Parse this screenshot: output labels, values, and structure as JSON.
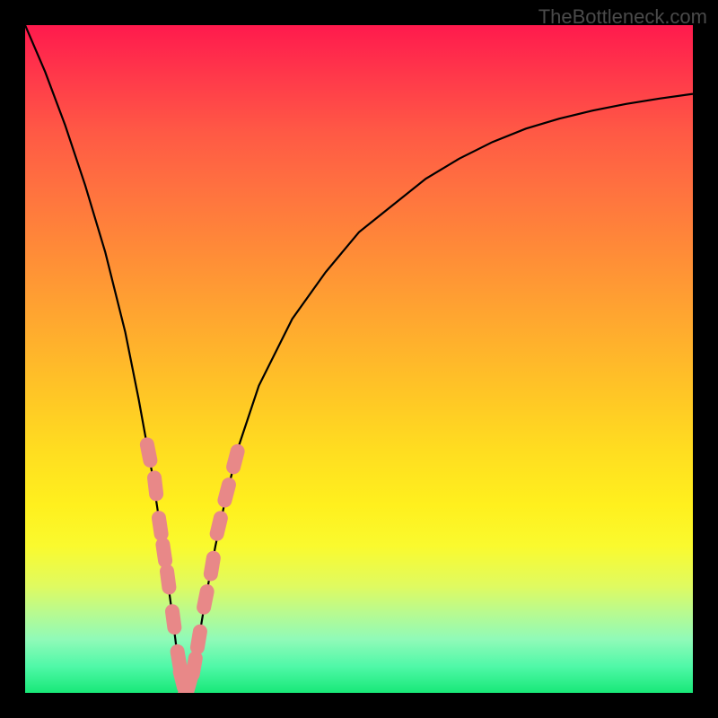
{
  "watermark": "TheBottleneck.com",
  "chart_data": {
    "type": "line",
    "title": "",
    "xlabel": "",
    "ylabel": "",
    "xlim": [
      0,
      100
    ],
    "ylim": [
      0,
      100
    ],
    "minimum_x": 24,
    "series": [
      {
        "name": "curve",
        "x": [
          0,
          3,
          6,
          9,
          12,
          15,
          17,
          19,
          20.5,
          22,
          23,
          24,
          25,
          26,
          27,
          28.5,
          30,
          32,
          35,
          40,
          45,
          50,
          55,
          60,
          65,
          70,
          75,
          80,
          85,
          90,
          95,
          100
        ],
        "y": [
          100,
          93,
          85,
          76,
          66,
          54,
          44,
          33,
          23,
          12,
          4,
          0,
          3,
          8,
          14,
          22,
          29,
          37,
          46,
          56,
          63,
          69,
          73,
          77,
          80,
          82.5,
          84.5,
          86,
          87.2,
          88.2,
          89,
          89.7
        ]
      }
    ],
    "markers": {
      "name": "highlighted-points",
      "color": "#e88888",
      "points": [
        {
          "x": 18.5,
          "y": 36
        },
        {
          "x": 19.5,
          "y": 31
        },
        {
          "x": 20.2,
          "y": 25
        },
        {
          "x": 20.8,
          "y": 21
        },
        {
          "x": 21.4,
          "y": 17
        },
        {
          "x": 22.2,
          "y": 11
        },
        {
          "x": 23,
          "y": 5
        },
        {
          "x": 23.5,
          "y": 2
        },
        {
          "x": 24,
          "y": 0
        },
        {
          "x": 24.6,
          "y": 1.5
        },
        {
          "x": 25.3,
          "y": 4
        },
        {
          "x": 26,
          "y": 8
        },
        {
          "x": 27,
          "y": 14
        },
        {
          "x": 28,
          "y": 19
        },
        {
          "x": 29,
          "y": 25
        },
        {
          "x": 30.2,
          "y": 30
        },
        {
          "x": 31.5,
          "y": 35
        }
      ]
    }
  }
}
